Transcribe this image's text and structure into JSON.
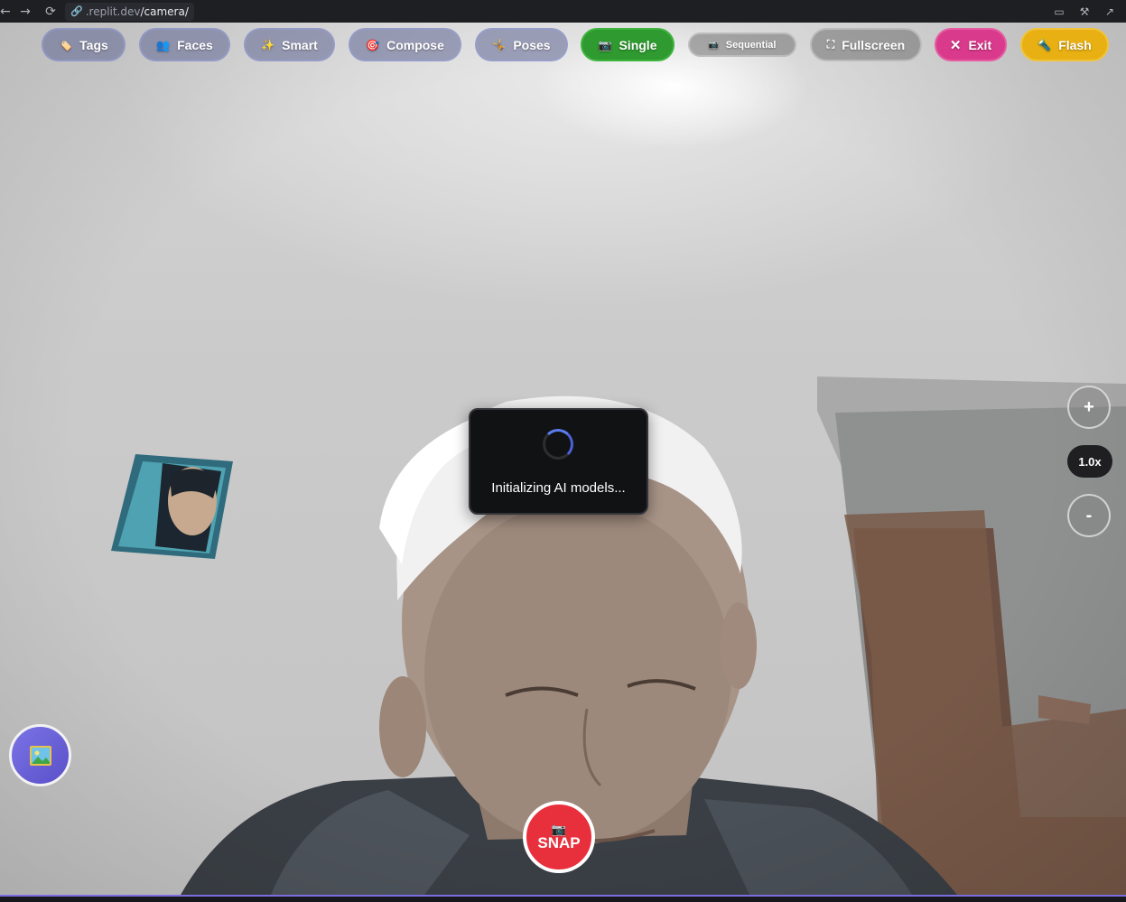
{
  "browser": {
    "url_prefix": ".replit.dev",
    "url_path": "/camera/",
    "icons": [
      "back-icon",
      "forward-icon",
      "reload-icon",
      "link-icon",
      "devices-icon",
      "wrench-icon",
      "open-external-icon"
    ]
  },
  "toolbar": {
    "tags": "Tags",
    "faces": "Faces",
    "smart": "Smart",
    "compose": "Compose",
    "poses": "Poses",
    "single": "Single",
    "sequential": "Sequential",
    "fullscreen": "Fullscreen",
    "exit": "Exit",
    "flash": "Flash",
    "icons": {
      "tags": "🏷️",
      "faces": "👥",
      "smart": "✨",
      "compose": "🎯",
      "poses": "🤸",
      "single": "📷",
      "sequential": "📷",
      "fullscreen": "⛶",
      "exit": "✕",
      "flash": "🔦"
    }
  },
  "loading": {
    "text": "Initializing AI models..."
  },
  "zoom": {
    "in": "+",
    "level": "1.0x",
    "out": "-"
  },
  "gallery": {
    "icon": "image-gallery-icon"
  },
  "snap": {
    "icon": "📷",
    "label": "SNAP"
  },
  "colors": {
    "single": "#2f9a2f",
    "exit": "#d93a8c",
    "flash": "#e8b013",
    "snap": "#e8303c",
    "spinner": "#5c7cf0",
    "accent_line": "#7b6de0"
  }
}
